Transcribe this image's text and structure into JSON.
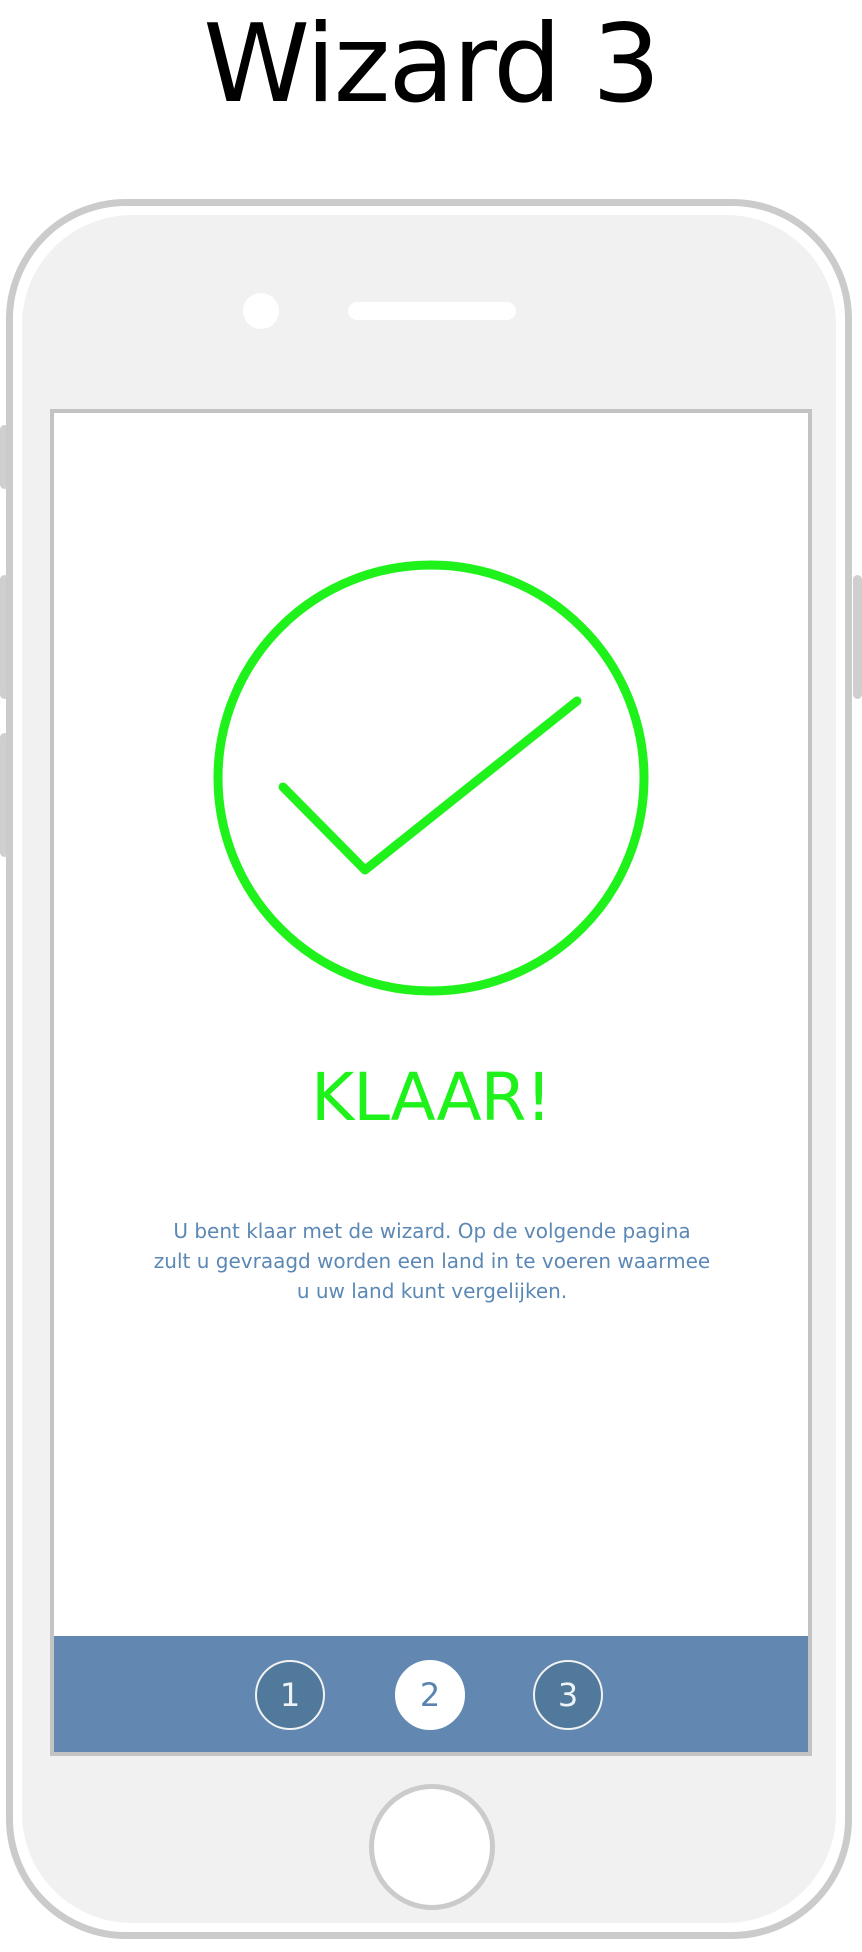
{
  "page": {
    "title": "Wizard 3"
  },
  "screen": {
    "success_icon": "check-circle-icon",
    "heading": "KLAAR!",
    "message_lines": [
      "U bent klaar met de wizard. Op de volgende pagina",
      "zult u gevraagd worden een land in te voeren waarmee",
      "u uw land kunt vergelijken."
    ]
  },
  "steps": [
    {
      "label": "1",
      "active": false
    },
    {
      "label": "2",
      "active": true
    },
    {
      "label": "3",
      "active": false
    }
  ],
  "colors": {
    "success_green": "#1ef21a",
    "message_blue": "#5b88b4",
    "step_bar": "#6287b1",
    "step_inactive": "#51799c",
    "phone_frame": "#cbcbcb"
  }
}
